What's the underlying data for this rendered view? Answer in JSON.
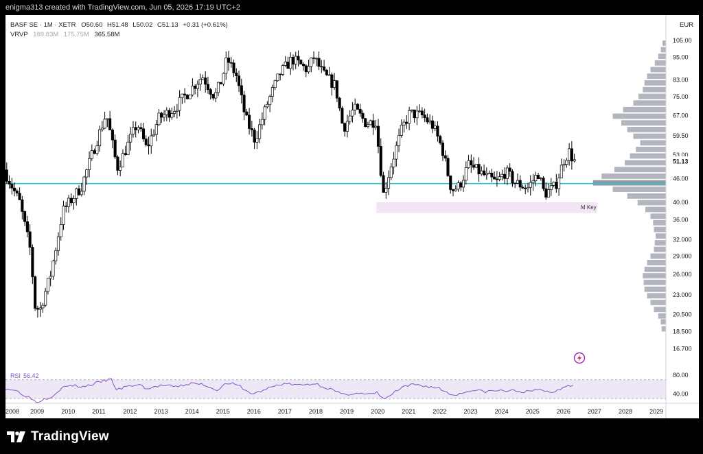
{
  "header": {
    "credit": "enigma313 created with TradingView.com, Jun 05, 2026 17:19 UTC+2"
  },
  "legend": {
    "symbol": "BASF SE · 1M · XETR",
    "open_label": "O",
    "open": "50.60",
    "high_label": "H",
    "high": "51.48",
    "low_label": "L",
    "low": "50.02",
    "close_label": "C",
    "close": "51.13",
    "change": "+0.31 (+0.61%)",
    "vrvp_label": "VRVP",
    "vrvp_v1": "189.83M",
    "vrvp_v2": "175.75M",
    "vrvp_v3": "365.58M"
  },
  "currency": "EUR",
  "rsi_label": "RSI",
  "rsi_value": "56.42",
  "zone_label": "M Key",
  "brand": "TradingView",
  "colors": {
    "up": "#ffffff",
    "down": "#000000",
    "hline": "#26c6da",
    "rsi": "#7e57c2",
    "zone": "#f3e5f5",
    "profile": "#b2b5be",
    "profile_poc": "#9598a1"
  },
  "chart_data": {
    "type": "candlestick",
    "interval": "1M",
    "scale": "log",
    "ylim": [
      17.5,
      108
    ],
    "price_ticks": [
      "105.00",
      "95.00",
      "83.00",
      "75.00",
      "67.00",
      "59.50",
      "53.00",
      "46.00",
      "40.00",
      "36.00",
      "32.000",
      "29.000",
      "26.000",
      "23.000",
      "20.500",
      "18.500",
      "16.700"
    ],
    "last_price": "51.13",
    "x_ticks": [
      "2008",
      "2009",
      "2010",
      "2011",
      "2012",
      "2013",
      "2014",
      "2015",
      "2016",
      "2017",
      "2018",
      "2019",
      "2020",
      "2021",
      "2022",
      "2023",
      "2024",
      "2025",
      "2026",
      "2027",
      "2028",
      "2029"
    ],
    "horizontal_line": 44.7,
    "zone": {
      "label": "M Key",
      "from": 37.5,
      "to": 40.0,
      "start": 2020.2
    },
    "price_path": [
      [
        2008.0,
        48.5
      ],
      [
        2008.5,
        40.0
      ],
      [
        2008.85,
        30.0
      ],
      [
        2009.0,
        21.5
      ],
      [
        2009.15,
        21.0
      ],
      [
        2009.5,
        26.0
      ],
      [
        2009.9,
        38.0
      ],
      [
        2010.5,
        44.0
      ],
      [
        2011.0,
        58.0
      ],
      [
        2011.3,
        68.0
      ],
      [
        2011.65,
        49.0
      ],
      [
        2011.8,
        52.0
      ],
      [
        2012.3,
        64.0
      ],
      [
        2012.6,
        55.0
      ],
      [
        2013.0,
        66.0
      ],
      [
        2013.5,
        70.0
      ],
      [
        2014.0,
        78.0
      ],
      [
        2014.4,
        85.0
      ],
      [
        2014.8,
        75.0
      ],
      [
        2015.0,
        82.0
      ],
      [
        2015.2,
        94.0
      ],
      [
        2015.5,
        85.0
      ],
      [
        2015.8,
        66.0
      ],
      [
        2016.1,
        58.0
      ],
      [
        2016.5,
        72.0
      ],
      [
        2016.9,
        86.0
      ],
      [
        2017.3,
        94.0
      ],
      [
        2017.8,
        88.0
      ],
      [
        2018.0,
        95.0
      ],
      [
        2018.3,
        86.0
      ],
      [
        2018.7,
        80.0
      ],
      [
        2018.95,
        62.0
      ],
      [
        2019.3,
        70.0
      ],
      [
        2019.7,
        64.0
      ],
      [
        2020.0,
        65.0
      ],
      [
        2020.25,
        42.0
      ],
      [
        2020.5,
        50.0
      ],
      [
        2020.85,
        62.0
      ],
      [
        2021.1,
        68.0
      ],
      [
        2021.5,
        67.0
      ],
      [
        2021.85,
        63.0
      ],
      [
        2022.15,
        55.0
      ],
      [
        2022.45,
        43.0
      ],
      [
        2022.7,
        44.0
      ],
      [
        2023.0,
        50.0
      ],
      [
        2023.5,
        47.0
      ],
      [
        2023.9,
        45.0
      ],
      [
        2024.2,
        48.0
      ],
      [
        2024.5,
        45.0
      ],
      [
        2024.9,
        43.5
      ],
      [
        2025.25,
        47.5
      ],
      [
        2025.45,
        42.0
      ],
      [
        2025.8,
        44.0
      ],
      [
        2026.1,
        52.0
      ],
      [
        2026.25,
        54.0
      ],
      [
        2026.4,
        51.13
      ]
    ],
    "volume_profile": [
      [
        18.8,
        0.05
      ],
      [
        19.6,
        0.06
      ],
      [
        20.3,
        0.09
      ],
      [
        21.1,
        0.14
      ],
      [
        22.0,
        0.18
      ],
      [
        22.9,
        0.22
      ],
      [
        23.8,
        0.25
      ],
      [
        24.8,
        0.26
      ],
      [
        25.8,
        0.27
      ],
      [
        26.8,
        0.25
      ],
      [
        27.9,
        0.22
      ],
      [
        29.0,
        0.18
      ],
      [
        30.2,
        0.14
      ],
      [
        31.4,
        0.13
      ],
      [
        32.7,
        0.12
      ],
      [
        34.0,
        0.14
      ],
      [
        35.4,
        0.15
      ],
      [
        36.8,
        0.18
      ],
      [
        38.3,
        0.24
      ],
      [
        39.9,
        0.33
      ],
      [
        41.5,
        0.45
      ],
      [
        43.2,
        0.62
      ],
      [
        44.9,
        0.85
      ],
      [
        46.7,
        0.75
      ],
      [
        48.6,
        0.6
      ],
      [
        50.6,
        0.48
      ],
      [
        52.7,
        0.42
      ],
      [
        54.8,
        0.35
      ],
      [
        57.0,
        0.3
      ],
      [
        59.3,
        0.38
      ],
      [
        61.7,
        0.45
      ],
      [
        64.2,
        0.52
      ],
      [
        66.8,
        0.62
      ],
      [
        69.5,
        0.5
      ],
      [
        72.3,
        0.38
      ],
      [
        75.2,
        0.32
      ],
      [
        78.3,
        0.27
      ],
      [
        81.5,
        0.25
      ],
      [
        84.8,
        0.22
      ],
      [
        88.2,
        0.18
      ],
      [
        91.8,
        0.13
      ],
      [
        95.5,
        0.09
      ],
      [
        99.3,
        0.06
      ],
      [
        103.3,
        0.04
      ]
    ],
    "rsi": {
      "ylim": [
        20,
        90
      ],
      "ticks": [
        "80.00",
        "40.00"
      ],
      "band": [
        30,
        70
      ],
      "path": [
        [
          2008.0,
          52
        ],
        [
          2008.3,
          48
        ],
        [
          2008.6,
          38
        ],
        [
          2008.85,
          30
        ],
        [
          2009.0,
          22
        ],
        [
          2009.2,
          28
        ],
        [
          2009.5,
          35
        ],
        [
          2009.8,
          52
        ],
        [
          2010.1,
          58
        ],
        [
          2010.5,
          55
        ],
        [
          2010.9,
          62
        ],
        [
          2011.2,
          68
        ],
        [
          2011.4,
          72
        ],
        [
          2011.6,
          48
        ],
        [
          2011.9,
          55
        ],
        [
          2012.3,
          60
        ],
        [
          2012.6,
          50
        ],
        [
          2013.0,
          58
        ],
        [
          2013.5,
          55
        ],
        [
          2014.0,
          62
        ],
        [
          2014.4,
          60
        ],
        [
          2014.8,
          48
        ],
        [
          2015.2,
          64
        ],
        [
          2015.6,
          55
        ],
        [
          2015.9,
          40
        ],
        [
          2016.2,
          44
        ],
        [
          2016.6,
          55
        ],
        [
          2017.0,
          62
        ],
        [
          2017.5,
          58
        ],
        [
          2018.0,
          62
        ],
        [
          2018.5,
          50
        ],
        [
          2018.9,
          38
        ],
        [
          2019.3,
          42
        ],
        [
          2019.7,
          38
        ],
        [
          2020.0,
          42
        ],
        [
          2020.25,
          28
        ],
        [
          2020.6,
          45
        ],
        [
          2020.9,
          55
        ],
        [
          2021.2,
          60
        ],
        [
          2021.6,
          56
        ],
        [
          2022.0,
          52
        ],
        [
          2022.4,
          38
        ],
        [
          2022.7,
          40
        ],
        [
          2023.0,
          48
        ],
        [
          2023.5,
          45
        ],
        [
          2024.0,
          47
        ],
        [
          2024.5,
          46
        ],
        [
          2024.9,
          44
        ],
        [
          2025.3,
          50
        ],
        [
          2025.6,
          42
        ],
        [
          2025.9,
          50
        ],
        [
          2026.15,
          60
        ],
        [
          2026.4,
          56.42
        ]
      ]
    }
  }
}
